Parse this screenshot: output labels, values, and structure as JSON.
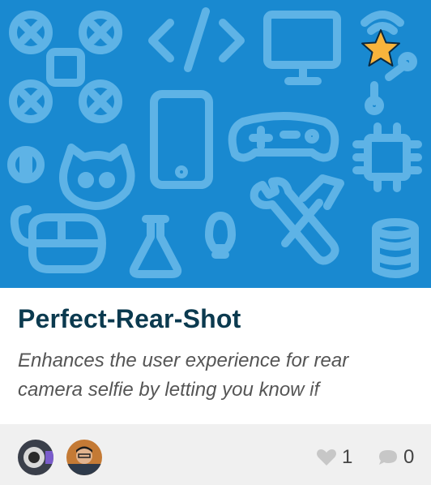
{
  "project": {
    "title": "Perfect-Rear-Shot",
    "description": "Enhances the user experience for rear camera selfie by letting you know if",
    "featured": true
  },
  "icons": {
    "hero": [
      "drone-icon",
      "code-icon",
      "monitor-icon",
      "wifi-circuit-icon",
      "phone-icon",
      "gamepad-icon",
      "dollar-icon",
      "octocat-icon",
      "chip-icon",
      "mouse-icon",
      "flask-icon",
      "lightbulb-icon",
      "tools-icon",
      "database-icon"
    ],
    "featured": "star-icon",
    "likes": "heart-icon",
    "comments": "comment-icon"
  },
  "footer": {
    "likes": "1",
    "comments": "0",
    "members": [
      "avatar-1",
      "avatar-2"
    ]
  },
  "colors": {
    "hero_bg": "#1989d0",
    "title": "#0b3a4f",
    "star": "#f7b43c",
    "footer_bg": "#f0f0f0"
  }
}
